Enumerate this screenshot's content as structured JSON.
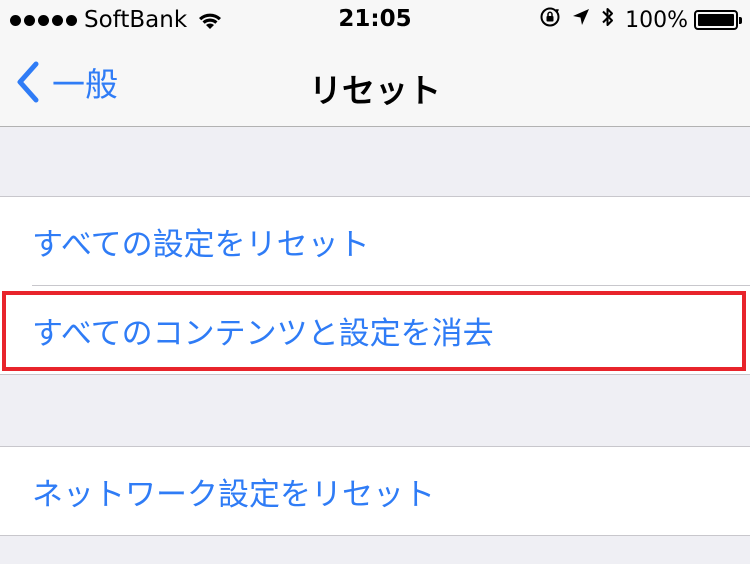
{
  "status_bar": {
    "carrier": "SoftBank",
    "time": "21:05",
    "battery_percent": "100%",
    "battery_level": 1.0,
    "icons": [
      "signal-dots",
      "wifi-icon",
      "rotation-lock-icon",
      "location-icon",
      "bluetooth-icon",
      "battery-icon"
    ]
  },
  "nav": {
    "back_label": "一般",
    "title": "リセット"
  },
  "groups": [
    {
      "items": [
        {
          "label": "すべての設定をリセット"
        },
        {
          "label": "すべてのコンテンツと設定を消去",
          "highlighted": true
        }
      ]
    },
    {
      "items": [
        {
          "label": "ネットワーク設定をリセット"
        }
      ]
    }
  ],
  "colors": {
    "accent": "#2f7cf6",
    "highlight": "#e8242b",
    "background": "#efeff4"
  }
}
